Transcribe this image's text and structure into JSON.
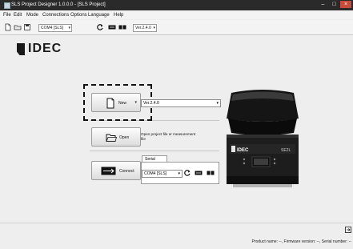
{
  "window": {
    "title": "SLS Project Designer 1.0.0.0 - [SLS Project]"
  },
  "menu": {
    "items": [
      "File",
      "Edit",
      "Mode",
      "Connections",
      "Options",
      "Language",
      "Help"
    ]
  },
  "toolbar": {
    "icons": [
      "new-file-icon",
      "open-folder-icon",
      "save-icon"
    ],
    "port_select": "COM4 [SLS]",
    "version_select": "Ver.2.4.0",
    "dropdown_glyph": "▾"
  },
  "logo": {
    "text": "IDEC"
  },
  "start": {
    "new_label": "New",
    "new_dropdown": "▾",
    "version_select": "Ver.2.4.0",
    "open_label": "Open",
    "open_description": "Open project file or measurement file",
    "connect_label": "Connect",
    "serial_tab": "Serial",
    "com_select": "COM4 [SLS]"
  },
  "device": {
    "brand": "IDEC",
    "model": "SE2L"
  },
  "status": {
    "text": "Product name: --, Firmware version: --, Serial number: --"
  },
  "colors": {
    "title_bar": "#2a2a2a",
    "close_button": "#c94b3b",
    "background": "#eeeeee"
  }
}
